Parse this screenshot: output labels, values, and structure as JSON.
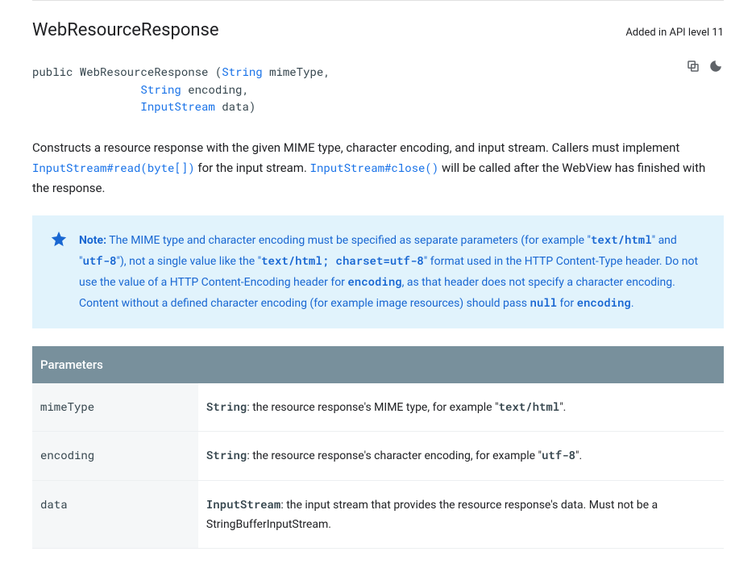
{
  "title": "WebResourceResponse",
  "api_level": "Added in API level 11",
  "signature": {
    "prefix": "public WebResourceResponse (",
    "params": [
      {
        "type": "String",
        "name": " mimeType,"
      },
      {
        "type": "String",
        "name": " encoding,"
      },
      {
        "type": "InputStream",
        "name": " data)"
      }
    ],
    "indent": "                "
  },
  "description": {
    "before_read": "Constructs a resource response with the given MIME type, character encoding, and input stream. Callers must implement ",
    "read_link": "InputStream#read(byte[])",
    "between": " for the input stream. ",
    "close_link": "InputStream#close()",
    "after_close": " will be called after the WebView has finished with the response."
  },
  "note": {
    "label": "Note:",
    "t1": " The MIME type and character encoding must be specified as separate parameters (for example \"",
    "m1": "text/html",
    "t2": "\" and \"",
    "m2": "utf-8",
    "t3": "\"), not a single value like the \"",
    "m3": "text/html; charset=utf-8",
    "t4": "\" format used in the HTTP Content-Type header. Do not use the value of a HTTP Content-Encoding header for ",
    "m4": "encoding",
    "t5": ", as that header does not specify a character encoding. Content without a defined character encoding (for example image resources) should pass ",
    "m5": "null",
    "t6": " for ",
    "m6": "encoding",
    "t7": "."
  },
  "params_header": "Parameters",
  "params": [
    {
      "name": "mimeType",
      "type": "String",
      "desc_before": ": the resource response's MIME type, for example \"",
      "mono": "text/html",
      "desc_after": "\"."
    },
    {
      "name": "encoding",
      "type": "String",
      "desc_before": ": the resource response's character encoding, for example \"",
      "mono": "utf-8",
      "desc_after": "\"."
    },
    {
      "name": "data",
      "type": "InputStream",
      "desc_before": ": the input stream that provides the resource response's data. Must not be a StringBufferInputStream.",
      "mono": "",
      "desc_after": ""
    }
  ]
}
